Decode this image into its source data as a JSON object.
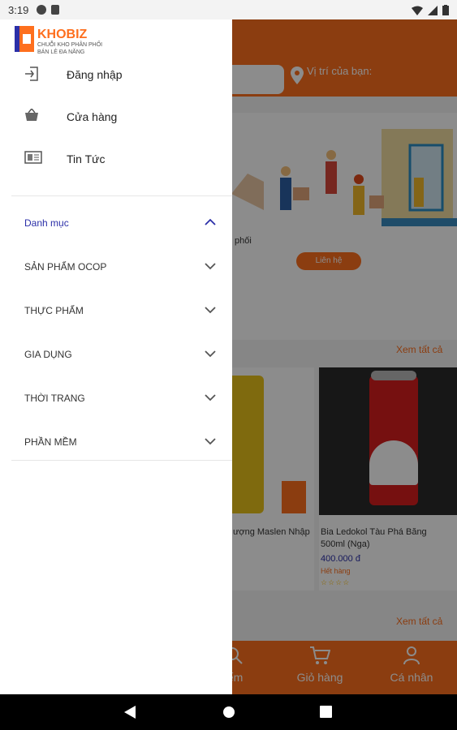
{
  "status_bar": {
    "time": "3:19"
  },
  "background": {
    "location_label": "Vị trí của bạn:",
    "banner_text": "phối",
    "contact_button": "Liên hệ",
    "see_all_1": "Xem tất cả",
    "see_all_2": "Xem tất cả",
    "product_1": {
      "name": "ượng Maslen Nhập"
    },
    "product_2": {
      "name": "Bia Ledokol Tàu Phá Băng 500ml (Nga)",
      "price": "400.000 đ",
      "status": "Hết hàng",
      "rating_stars": 0
    },
    "bottom_nav": {
      "search": "iếm",
      "cart": "Giỏ hàng",
      "profile": "Cá nhân"
    }
  },
  "drawer": {
    "brand": "KHOBIZ",
    "tagline_1": "CHUỖI KHO PHÂN PHỐI",
    "tagline_2": "BÁN LẺ ĐA NĂNG",
    "menu": [
      {
        "label": "Đăng nhập",
        "icon": "login-icon"
      },
      {
        "label": "Cửa hàng",
        "icon": "basket-icon"
      },
      {
        "label": "Tin Tức",
        "icon": "news-icon"
      }
    ],
    "category_header": "Danh mục",
    "categories": [
      "SẢN PHẨM OCOP",
      "THỰC PHẨM",
      "GIA DỤNG",
      "THỜI TRANG",
      "PHẦN MỀM"
    ]
  },
  "colors": {
    "accent": "#fe6f1e",
    "link": "#2b2fa8"
  }
}
